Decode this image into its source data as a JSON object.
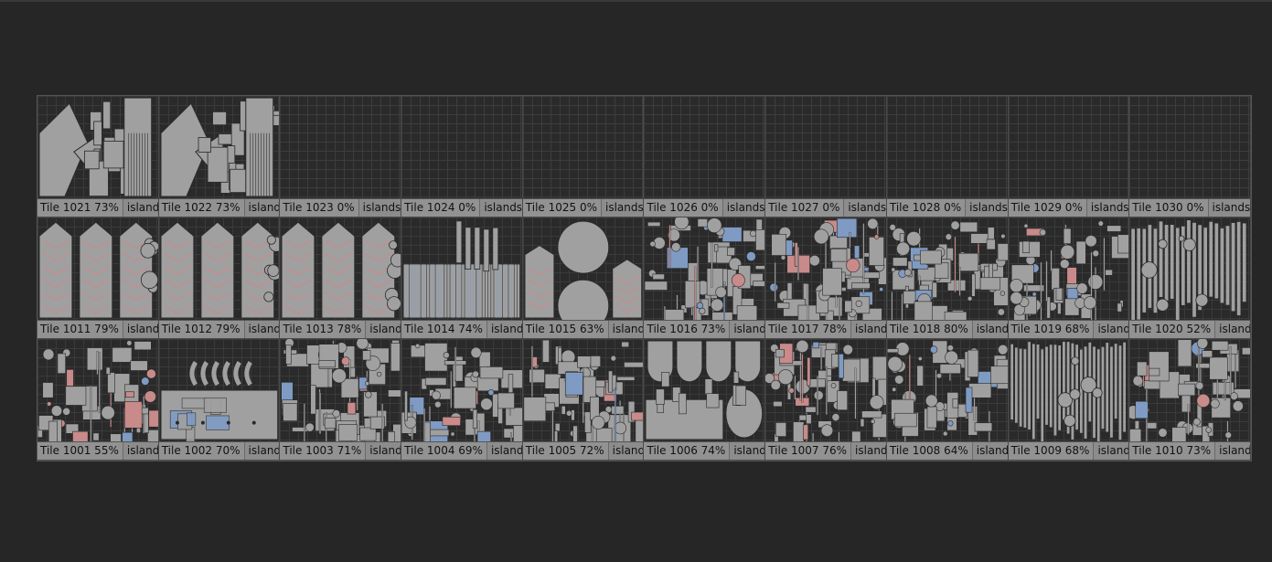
{
  "viewport": {
    "label_suffix": "islands",
    "rows": [
      [
        {
          "name": "Tile  1021 73%",
          "fill": 0.73,
          "mode": "islands",
          "style": "blocks"
        },
        {
          "name": "Tile  1022 73%",
          "fill": 0.73,
          "mode": "islands",
          "style": "blocks"
        },
        {
          "name": "Tile  1023 0%",
          "fill": 0.0,
          "mode": "islands",
          "style": "empty"
        },
        {
          "name": "Tile  1024 0%",
          "fill": 0.0,
          "mode": "islands",
          "style": "empty"
        },
        {
          "name": "Tile  1025 0%",
          "fill": 0.0,
          "mode": "islands",
          "style": "empty"
        },
        {
          "name": "Tile  1026 0%",
          "fill": 0.0,
          "mode": "islands",
          "style": "empty"
        },
        {
          "name": "Tile  1027 0%",
          "fill": 0.0,
          "mode": "islands",
          "style": "empty"
        },
        {
          "name": "Tile  1028 0%",
          "fill": 0.0,
          "mode": "islands",
          "style": "empty"
        },
        {
          "name": "Tile  1029 0%",
          "fill": 0.0,
          "mode": "islands",
          "style": "empty"
        },
        {
          "name": "Tile  1030 0%",
          "fill": 0.0,
          "mode": "islands",
          "style": "empty"
        }
      ],
      [
        {
          "name": "Tile  1011 79%",
          "fill": 0.79,
          "mode": "islands",
          "style": "arrows"
        },
        {
          "name": "Tile  1012 79%",
          "fill": 0.79,
          "mode": "islands",
          "style": "arrows"
        },
        {
          "name": "Tile  1013 78%",
          "fill": 0.78,
          "mode": "islands",
          "style": "arrows"
        },
        {
          "name": "Tile  1014 74%",
          "fill": 0.74,
          "mode": "islands",
          "style": "strips"
        },
        {
          "name": "Tile  1015 63%",
          "fill": 0.63,
          "mode": "islands",
          "style": "circles"
        },
        {
          "name": "Tile  1016 73%",
          "fill": 0.73,
          "mode": "islands",
          "style": "dense"
        },
        {
          "name": "Tile  1017 78%",
          "fill": 0.78,
          "mode": "islands",
          "style": "dense"
        },
        {
          "name": "Tile  1018 80%",
          "fill": 0.8,
          "mode": "islands",
          "style": "dense"
        },
        {
          "name": "Tile  1019 68%",
          "fill": 0.68,
          "mode": "islands",
          "style": "dense"
        },
        {
          "name": "Tile  1020 52%",
          "fill": 0.52,
          "mode": "islands",
          "style": "lines"
        }
      ],
      [
        {
          "name": "Tile  1001 55%",
          "fill": 0.55,
          "mode": "islands",
          "style": "dense"
        },
        {
          "name": "Tile  1002 70%",
          "fill": 0.7,
          "mode": "islands",
          "style": "blocks2"
        },
        {
          "name": "Tile  1003 71%",
          "fill": 0.71,
          "mode": "islands",
          "style": "dense"
        },
        {
          "name": "Tile  1004 69%",
          "fill": 0.69,
          "mode": "islands",
          "style": "dense"
        },
        {
          "name": "Tile  1005 72%",
          "fill": 0.72,
          "mode": "islands",
          "style": "dense"
        },
        {
          "name": "Tile  1006 74%",
          "fill": 0.74,
          "mode": "islands",
          "style": "bowls"
        },
        {
          "name": "Tile  1007 76%",
          "fill": 0.76,
          "mode": "islands",
          "style": "dense"
        },
        {
          "name": "Tile  1008 64%",
          "fill": 0.64,
          "mode": "islands",
          "style": "dense"
        },
        {
          "name": "Tile  1009 68%",
          "fill": 0.68,
          "mode": "islands",
          "style": "lines"
        },
        {
          "name": "Tile  1010 73%",
          "fill": 0.73,
          "mode": "islands",
          "style": "dense"
        }
      ]
    ]
  },
  "colors": {
    "island_fill": "#a0a0a0",
    "island_stroke": "#2a2a2a",
    "accent_red": "#c98a8a",
    "accent_blue": "#7f9bc4"
  }
}
